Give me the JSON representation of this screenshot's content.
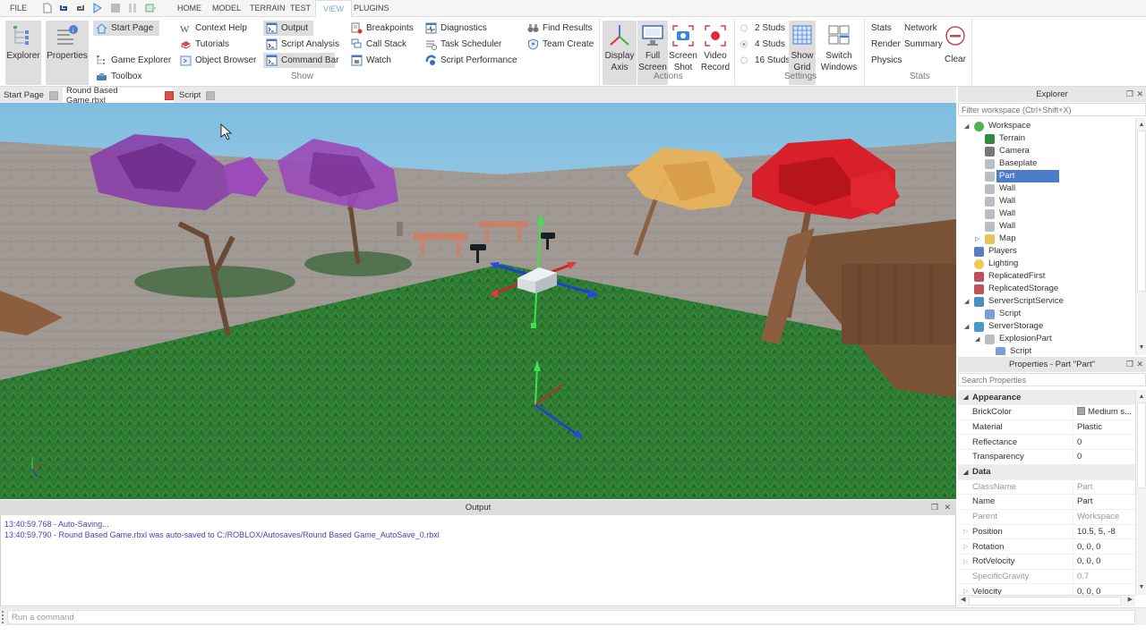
{
  "menubar": {
    "file": "FILE",
    "tabs": [
      "HOME",
      "MODEL",
      "TERRAIN",
      "TEST",
      "VIEW",
      "PLUGINS"
    ],
    "active_tab": "VIEW"
  },
  "ribbon": {
    "show_group": {
      "label": "Show",
      "explorer": "Explorer",
      "properties": "Properties",
      "start_page": "Start Page",
      "game_explorer": "Game Explorer",
      "toolbox": "Toolbox",
      "context_help": "Context Help",
      "tutorials": "Tutorials",
      "object_browser": "Object Browser",
      "output": "Output",
      "script_analysis": "Script Analysis",
      "command_bar": "Command Bar",
      "breakpoints": "Breakpoints",
      "call_stack": "Call Stack",
      "watch": "Watch",
      "diagnostics": "Diagnostics",
      "task_scheduler": "Task Scheduler",
      "script_performance": "Script Performance",
      "find_results": "Find Results",
      "team_create": "Team Create"
    },
    "actions_group": {
      "label": "Actions",
      "display_axis": [
        "Display",
        "Axis"
      ],
      "full_screen": [
        "Full",
        "Screen"
      ],
      "screen_shot": [
        "Screen",
        "Shot"
      ],
      "video_record": [
        "Video",
        "Record"
      ]
    },
    "settings_group": {
      "label": "Settings",
      "grid_sizes": [
        "2 Studs",
        "4 Studs",
        "16 Studs"
      ],
      "selected_grid": "4 Studs",
      "show_grid": [
        "Show",
        "Grid"
      ],
      "switch_windows": [
        "Switch",
        "Windows"
      ]
    },
    "stats_group": {
      "label": "Stats",
      "stats": "Stats",
      "render": "Render",
      "physics": "Physics",
      "network": "Network",
      "summary": "Summary",
      "clear": "Clear"
    }
  },
  "document_tabs": [
    {
      "label": "Start Page",
      "active": false
    },
    {
      "label": "Round Based Game.rbxl",
      "active": true
    },
    {
      "label": "Script",
      "active": false
    }
  ],
  "output": {
    "title": "Output",
    "lines": [
      "13:40:59.768 - Auto-Saving...",
      "13:40:59.790 - Round Based Game.rbxl was auto-saved to C:/ROBLOX/Autosaves/Round Based Game_AutoSave_0.rbxl"
    ]
  },
  "command_bar": {
    "placeholder": "Run a command"
  },
  "explorer": {
    "title": "Explorer",
    "filter_placeholder": "Filter workspace (Ctrl+Shift+X)",
    "items": [
      {
        "label": "Workspace",
        "icon": "workspace-icon",
        "depth": 0,
        "expanded": true
      },
      {
        "label": "Terrain",
        "icon": "terrain-icon",
        "depth": 1
      },
      {
        "label": "Camera",
        "icon": "camera-icon",
        "depth": 1
      },
      {
        "label": "Baseplate",
        "icon": "part-icon",
        "depth": 1
      },
      {
        "label": "Part",
        "icon": "part-icon",
        "depth": 1,
        "selected": true
      },
      {
        "label": "Wall",
        "icon": "part-icon",
        "depth": 1
      },
      {
        "label": "Wall",
        "icon": "part-icon",
        "depth": 1
      },
      {
        "label": "Wall",
        "icon": "part-icon",
        "depth": 1
      },
      {
        "label": "Wall",
        "icon": "part-icon",
        "depth": 1
      },
      {
        "label": "Map",
        "icon": "folder-icon",
        "depth": 1,
        "expanded": false
      },
      {
        "label": "Players",
        "icon": "players-icon",
        "depth": 0
      },
      {
        "label": "Lighting",
        "icon": "lighting-icon",
        "depth": 0
      },
      {
        "label": "ReplicatedFirst",
        "icon": "replicated-first-icon",
        "depth": 0
      },
      {
        "label": "ReplicatedStorage",
        "icon": "replicated-storage-icon",
        "depth": 0
      },
      {
        "label": "ServerScriptService",
        "icon": "server-script-service-icon",
        "depth": 0,
        "expanded": true
      },
      {
        "label": "Script",
        "icon": "script-icon",
        "depth": 1
      },
      {
        "label": "ServerStorage",
        "icon": "server-storage-icon",
        "depth": 0,
        "expanded": true
      },
      {
        "label": "ExplosionPart",
        "icon": "part-icon",
        "depth": 1,
        "expanded": true
      },
      {
        "label": "Script",
        "icon": "script-icon",
        "depth": 2
      }
    ]
  },
  "properties": {
    "title": "Properties - Part \"Part\"",
    "search_placeholder": "Search Properties",
    "rows": [
      {
        "type": "category",
        "name": "Appearance"
      },
      {
        "name": "BrickColor",
        "value": "Medium s...",
        "swatch": "#a3a2a5"
      },
      {
        "name": "Material",
        "value": "Plastic"
      },
      {
        "name": "Reflectance",
        "value": "0"
      },
      {
        "name": "Transparency",
        "value": "0"
      },
      {
        "type": "category",
        "name": "Data"
      },
      {
        "name": "ClassName",
        "value": "Part",
        "disabled": true
      },
      {
        "name": "Name",
        "value": "Part"
      },
      {
        "name": "Parent",
        "value": "Workspace",
        "disabled": true
      },
      {
        "name": "Position",
        "value": "10.5, 5, -8",
        "expandable": true
      },
      {
        "name": "Rotation",
        "value": "0, 0, 0",
        "expandable": true
      },
      {
        "name": "RotVelocity",
        "value": "0, 0, 0",
        "expandable": true
      },
      {
        "name": "SpecificGravity",
        "value": "0.7",
        "disabled": true
      },
      {
        "name": "Velocity",
        "value": "0, 0, 0",
        "expandable": true
      }
    ]
  },
  "colors": {
    "selection": "#4c7cc9",
    "output_text": "#4a3fb5",
    "active_tab_close": "#d9534f",
    "axis_x": "#d32f2f",
    "axis_y": "#2ecc40",
    "axis_z": "#1e3fd8"
  }
}
